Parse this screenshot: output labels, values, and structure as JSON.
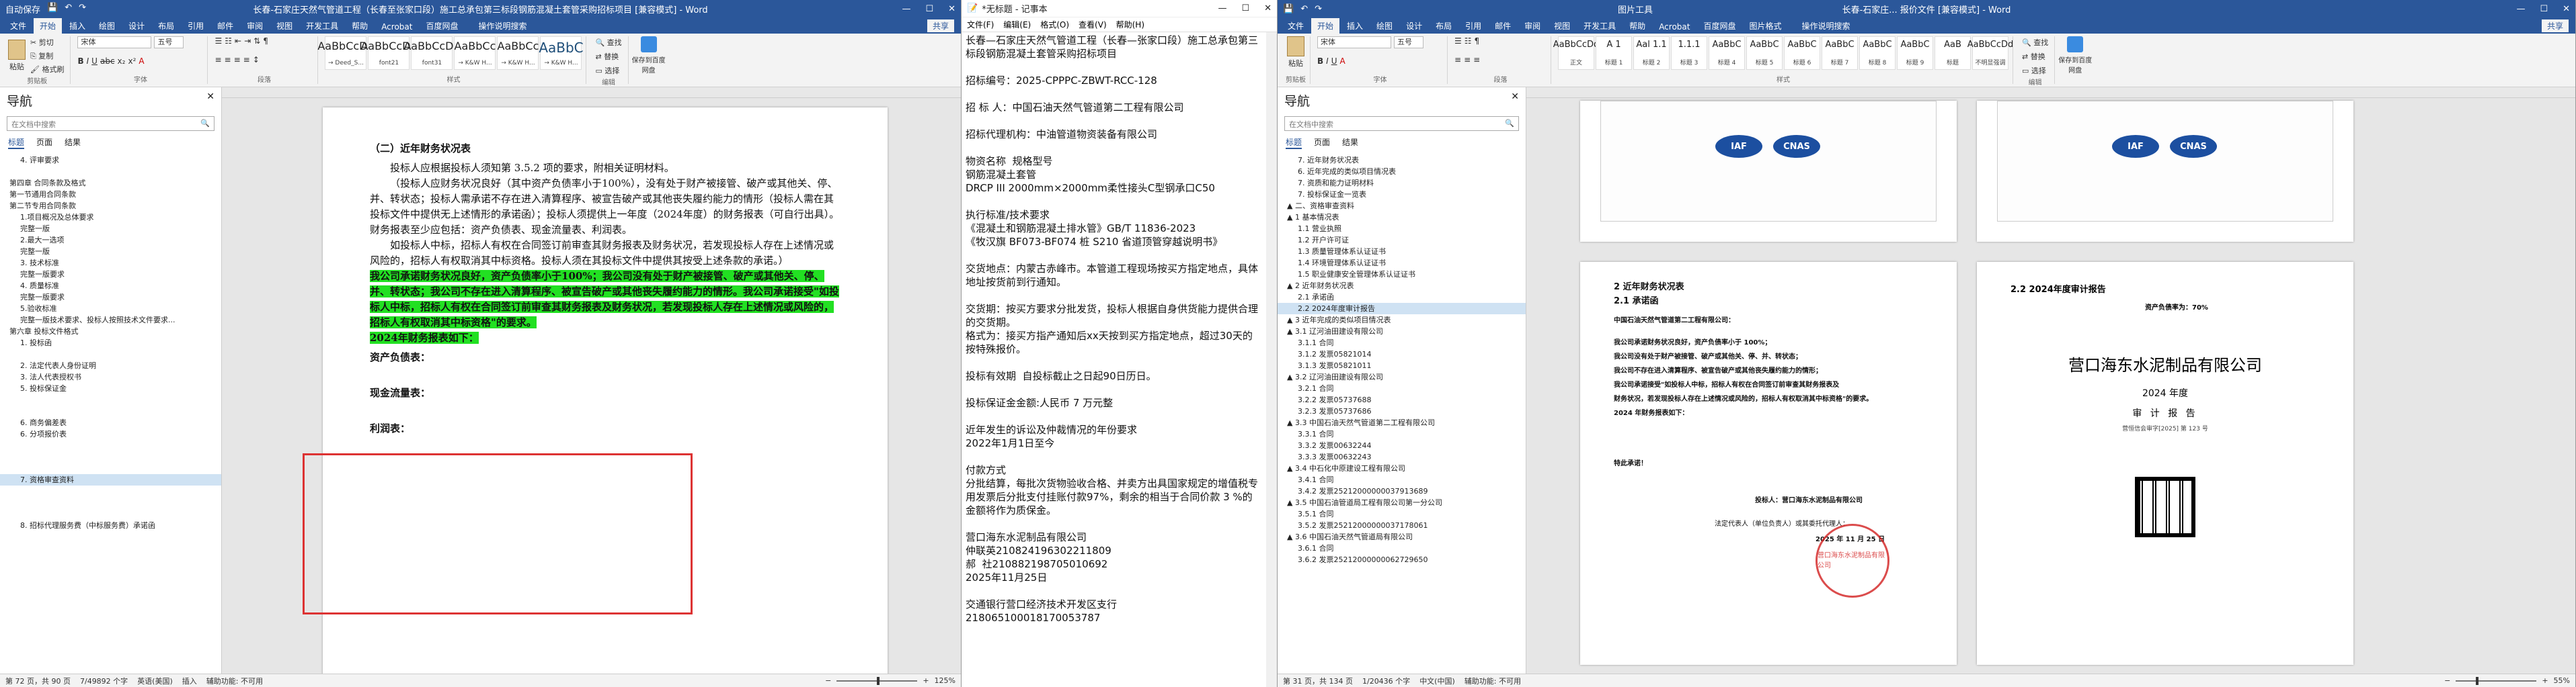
{
  "w1": {
    "qat": [
      "自动保存",
      "💾",
      "↶",
      "↷"
    ],
    "title": "长春-石家庄天然气管道工程（长春至张家口段）施工总承包第三标段钢筋混凝土套管采购招标项目 [兼容模式] - Word",
    "tabs": [
      "文件",
      "开始",
      "插入",
      "绘图",
      "设计",
      "布局",
      "引用",
      "邮件",
      "审阅",
      "视图",
      "开发工具",
      "帮助",
      "Acrobat",
      "百度网盘",
      "操作说明搜索"
    ],
    "share": "共享",
    "clipboard": {
      "paste": "粘贴",
      "cut": "剪切",
      "copy": "复制",
      "painter": "格式刷",
      "label": "剪贴板"
    },
    "font": {
      "name": "宋体",
      "size": "五号",
      "label": "字体"
    },
    "paragraph_label": "段落",
    "styles": [
      {
        "sample": "AaBbCcDd",
        "name": "→ Deed_S..."
      },
      {
        "sample": "AaBbCcDd",
        "name": "font21"
      },
      {
        "sample": "AaBbCcDd",
        "name": "font31"
      },
      {
        "sample": "AaBbCc",
        "name": "→ K&W H..."
      },
      {
        "sample": "AaBbCc",
        "name": "→ K&W H..."
      },
      {
        "sample": "AaBbC",
        "name": "→ K&W H..."
      }
    ],
    "styles_label": "样式",
    "editing": [
      "查找",
      "替换",
      "选择"
    ],
    "editing_label": "编辑",
    "save_baidu": "保存到百度网盘",
    "nav": {
      "title": "导航",
      "search_placeholder": "在文档中搜索",
      "tabs": [
        "标题",
        "页面",
        "结果"
      ],
      "items": [
        "4. 评审要求",
        "",
        "第四章 合同条款及格式",
        "第一节通用合同条款",
        "第二节专用合同条款",
        "1.项目概况及总体要求",
        "完整一版",
        "2.最大一选项",
        "完整一版",
        "3. 技术标准",
        "完整一版要求",
        "4. 质量标准",
        "完整一版要求",
        "5.验收标准",
        "完整一版技术要求、投标人按照技术文件要求...",
        "第六章 投标文件格式",
        "1. 投标函",
        "",
        "2. 法定代表人身份证明",
        "3. 法人代表授权书",
        "5. 投标保证金",
        "",
        "",
        "6. 商务偏差表",
        "6. 分项报价表",
        "",
        "",
        "",
        "7. 资格审查资料",
        "",
        "",
        "",
        "8. 招标代理服务费（中标服务费）承诺函"
      ],
      "selected_index": 28
    },
    "doc": {
      "heading": "（二）近年财务状况表",
      "p1": "投标人应根据投标人须知第 3.5.2 项的要求，附相关证明材料。",
      "p2": "（投标人应财务状况良好（其中资产负债率小于100%），没有处于财产被接管、破产或其他关、停、并、转状态；投标人需承诺不存在进入清算程序、被宣告破产或其他丧失履约能力的情形（投标人需在其投标文件中提供无上述情形的承诺函）；投标人须提供上一年度（2024年度）的财务报表（可自行出具）。财务报表至少应包括：资产负债表、现金流量表、利润表。",
      "p3": "如投标人中标，招标人有权在合同签订前审查其财务报表及财务状况，若发现投标人存在上述情况或风险的，招标人有权取消其中标资格。投标人须在其投标文件中提供其按受上述条款的承诺。）",
      "hl": "我公司承诺财务状况良好，资产负债率小于100%；我公司没有处于财产被接管、破产或其他关、停、并、转状态；我公司不存在进入清算程序、被宣告破产或其他丧失履约能力的情形。我公司承诺接受\"如投标人中标，招标人有权在合同签订前审查其财务报表及财务状况，若发现投标人存在上述情况或风险的，招标人有权取消其中标资格\"的要求。",
      "hl2": "2024年财务报表如下：",
      "items": [
        "资产负债表：",
        "现金流量表：",
        "利润表："
      ]
    },
    "status": {
      "page": "第 72 页，共 90 页",
      "words": "7/49892 个字",
      "lang": "英语(美国)",
      "ins": "插入",
      "acc": "辅助功能: 不可用",
      "zoom": "125%"
    }
  },
  "w2": {
    "title": "*无标题 - 记事本",
    "menu": [
      "文件(F)",
      "编辑(E)",
      "格式(O)",
      "查看(V)",
      "帮助(H)"
    ],
    "body": "长春—石家庄天然气管道工程（长春—张家口段）施工总承包第三标段钢筋混凝土套管采购招标项目\n\n招标编号：2025-CPPPC-ZBWT-RCC-128\n\n招 标 人：中国石油天然气管道第二工程有限公司\n\n招标代理机构：中油管道物资装备有限公司\n\n物资名称  规格型号\n钢筋混凝土套管\nDRCP III 2000mm×2000mm柔性接头C型钢承口C50\n\n执行标准/技术要求\n《混凝土和钢筋混凝土排水管》GB/T 11836-2023\n《牧汉旗 BF073-BF074 桩 S210 省道顶管穿越说明书》\n\n交货地点：内蒙古赤峰市。本管道工程现场按买方指定地点，具体地址按货前到行通知。\n\n交货期：按买方要求分批发货，投标人根据自身供货能力提供合理的交货期。\n格式为：接买方指产通知后xx天按到买方指定地点，超过30天的按特殊报价。\n\n投标有效期  自投标截止之日起90日历日。\n\n投标保证金金额:人民币 7 万元整\n\n近年发生的诉讼及仲裁情况的年份要求\n2022年1月1日至今\n\n付款方式\n分批结算，每批次货物验收合格、并卖方出具国家规定的增值税专用发票后分批支付挂账付款97%，剩余的相当于合同价款 3 %的金额将作为质保金。\n\n营口海东水泥制品有限公司\n仲联英21082419630221180​9\n郝  社21088219870​5010692\n2025年11月25日\n\n交通银行营口经济技术开发区支行\n21806510001817005378​7"
  },
  "w3": {
    "title": "长春-石家庄... 报价文件 [兼容模式] - Word",
    "tab_extra": "图片工具",
    "tabs": [
      "文件",
      "开始",
      "插入",
      "绘图",
      "设计",
      "布局",
      "引用",
      "邮件",
      "审阅",
      "视图",
      "开发工具",
      "帮助",
      "Acrobat",
      "百度网盘",
      "图片格式",
      "操作说明搜索"
    ],
    "share": "共享",
    "font": {
      "name": "宋体",
      "size": "五号"
    },
    "styles": [
      {
        "sample": "AaBbCcDd",
        "name": "正文"
      },
      {
        "sample": "A 1",
        "name": "标题 1"
      },
      {
        "sample": "Aal 1.1",
        "name": "标题 2"
      },
      {
        "sample": "1.1.1",
        "name": "标题 3"
      },
      {
        "sample": "AaBbC",
        "name": "标题 4"
      },
      {
        "sample": "AaBbC",
        "name": "标题 5"
      },
      {
        "sample": "AaBbC",
        "name": "标题 6"
      },
      {
        "sample": "AaBbC",
        "name": "标题 7"
      },
      {
        "sample": "AaBbC",
        "name": "标题 8"
      },
      {
        "sample": "AaBbC",
        "name": "标题 9"
      },
      {
        "sample": "AaB",
        "name": "标题"
      },
      {
        "sample": "AaBbCcDd",
        "name": "不明显强调"
      }
    ],
    "nav": {
      "title": "导航",
      "search_placeholder": "在文档中搜索",
      "tabs": [
        "标题",
        "页面",
        "结果"
      ],
      "items": [
        "7. 近年财务状况表",
        "6. 近年完成的类似项目情况表",
        "7. 资质和能力证明材料",
        "7. 投标保证金一览表",
        "▲ 二、资格审查资料",
        "▲ 1 基本情况表",
        "1.1 营业执照",
        "1.2 开户许可证",
        "1.3 质量管理体系认证证书",
        "1.4 环境管理体系认证证书",
        "1.5 职业健康安全管理体系认证证书",
        "▲ 2 近年财务状况表",
        "2.1 承诺函",
        "2.2 2024年度审计报告",
        "▲ 3 近年完成的类似项目情况表",
        "▲ 3.1 辽河油田建设有限公司",
        "3.1.1 合同",
        "3.1.2 发票05821014",
        "3.1.3 发票05821011",
        "▲ 3.2 辽河油田建设有限公司",
        "3.2.1 合同",
        "3.2.2 发票05737688",
        "3.2.3 发票05737686",
        "▲ 3.3 中国石油天然气管道第二工程有限公司",
        "3.3.1 合同",
        "3.3.2 发票00632244",
        "3.3.3 发票00632243",
        "▲ 3.4 中石化中原建设工程有限公司",
        "3.4.1 合同",
        "3.4.2 发票25212000000037913689",
        "▲ 3.5 中国石油管道局工程有限公司第一分公司",
        "3.5.1 合同",
        "3.5.2 发票25212000000037178061",
        "▲ 3.6 中国石油天然气管道局有限公司",
        "3.6.1 合同",
        "3.6.2 发票25212000000062729650"
      ],
      "selected_index": 13
    },
    "page_left": {
      "heading": "2 近年财务状况表",
      "sub": "2.1 承诺函",
      "to": "中国石油天然气管道第二工程有限公司：",
      "lines": [
        "我公司承诺财务状况良好，资产负债率小于 100%；",
        "我公司没有处于财产被接管、破产或其他关、停、并、转状态；",
        "我公司不存在进入清算程序、被宣告破产或其他丧失履约能力的情形；",
        "我公司承诺接受\"如投标人中标，招标人有权在合同签订前审查其财务报表及",
        "财务状况，若发现投标人存在上述情况或风险的，招标人有权取消其中标资格\"的要求。",
        "2024 年财务报表如下："
      ],
      "end": "特此承诺！",
      "sign_company": "投标人：营口海东水泥制品有限公司",
      "sign_rep": "法定代表人（单位负责人）或其委托代理人：",
      "date": "2025 年 11 月 25 日",
      "stamp_text": "营口海东水泥制品有限公司"
    },
    "page_right": {
      "heading": "2.2 2024年度审计报告",
      "note": "资产负债率为：70%",
      "company": "营口海东水泥制品有限公司",
      "year": "2024 年度",
      "report": "审 计 报 告",
      "report_no": "营恒信会审字[2025] 第 123 号"
    },
    "status": {
      "page": "第 31 页，共 134 页",
      "words": "1/20436 个字",
      "lang": "中文(中国)",
      "acc": "辅助功能: 不可用",
      "zoom": "55%"
    }
  }
}
